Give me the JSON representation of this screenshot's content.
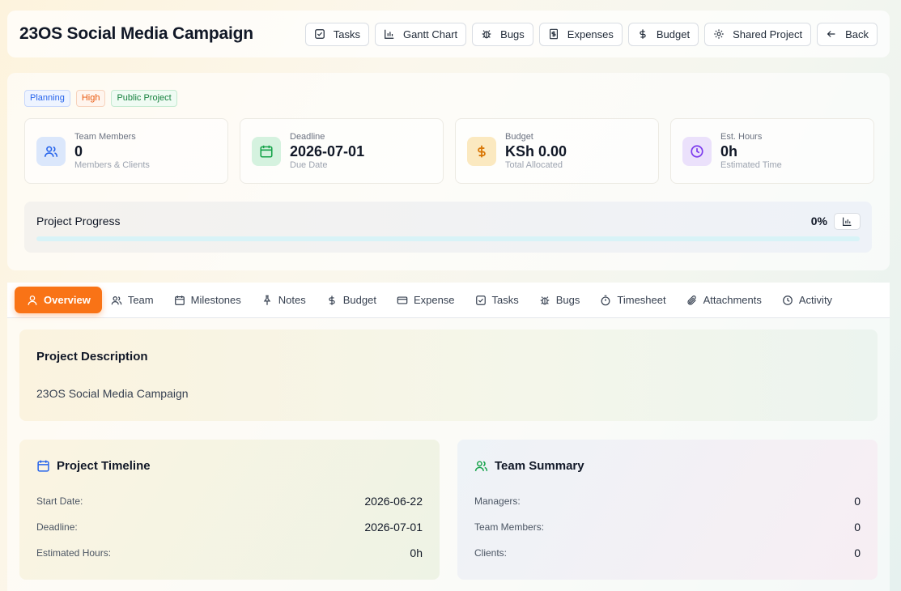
{
  "header": {
    "title": "23OS Social Media Campaign",
    "actions": [
      {
        "label": "Tasks",
        "icon": "checkbox-icon"
      },
      {
        "label": "Gantt Chart",
        "icon": "bar-chart-icon"
      },
      {
        "label": "Bugs",
        "icon": "bug-icon"
      },
      {
        "label": "Expenses",
        "icon": "receipt-icon"
      },
      {
        "label": "Budget",
        "icon": "dollar-icon"
      },
      {
        "label": "Shared Project",
        "icon": "gear-icon"
      },
      {
        "label": "Back",
        "icon": "arrow-left-icon"
      }
    ]
  },
  "badges": {
    "status": "Planning",
    "priority": "High",
    "visibility": "Public Project"
  },
  "stats": [
    {
      "label": "Team Members",
      "value": "0",
      "sub": "Members & Clients",
      "icon": "users-icon",
      "color": "#2563eb",
      "bg": "#dbe7fb"
    },
    {
      "label": "Deadline",
      "value": "2026-07-01",
      "sub": "Due Date",
      "icon": "calendar-icon",
      "color": "#16a34a",
      "bg": "#d5f2df"
    },
    {
      "label": "Budget",
      "value": "KSh 0.00",
      "sub": "Total Allocated",
      "icon": "dollar-icon",
      "color": "#d97706",
      "bg": "#fbe9c0"
    },
    {
      "label": "Est. Hours",
      "value": "0h",
      "sub": "Estimated Time",
      "icon": "clock-icon",
      "color": "#7c3aed",
      "bg": "#ebe1fb"
    }
  ],
  "progress": {
    "label": "Project Progress",
    "percent_text": "0%",
    "value": 0
  },
  "tabs": [
    {
      "label": "Overview",
      "icon": "user-icon",
      "active": true
    },
    {
      "label": "Team",
      "icon": "users-icon"
    },
    {
      "label": "Milestones",
      "icon": "calendar-icon"
    },
    {
      "label": "Notes",
      "icon": "pin-icon"
    },
    {
      "label": "Budget",
      "icon": "dollar-icon"
    },
    {
      "label": "Expense",
      "icon": "credit-card-icon"
    },
    {
      "label": "Tasks",
      "icon": "checkbox-icon"
    },
    {
      "label": "Bugs",
      "icon": "bug-icon"
    },
    {
      "label": "Timesheet",
      "icon": "timer-icon"
    },
    {
      "label": "Attachments",
      "icon": "paperclip-icon"
    },
    {
      "label": "Activity",
      "icon": "clock-icon"
    }
  ],
  "description": {
    "title": "Project Description",
    "text": "23OS Social Media Campaign"
  },
  "timeline": {
    "title": "Project Timeline",
    "rows": [
      {
        "key": "Start Date:",
        "value": "2026-06-22"
      },
      {
        "key": "Deadline:",
        "value": "2026-07-01"
      },
      {
        "key": "Estimated Hours:",
        "value": "0h"
      }
    ]
  },
  "team_summary": {
    "title": "Team Summary",
    "rows": [
      {
        "key": "Managers:",
        "value": "0"
      },
      {
        "key": "Team Members:",
        "value": "0"
      },
      {
        "key": "Clients:",
        "value": "0"
      }
    ]
  }
}
